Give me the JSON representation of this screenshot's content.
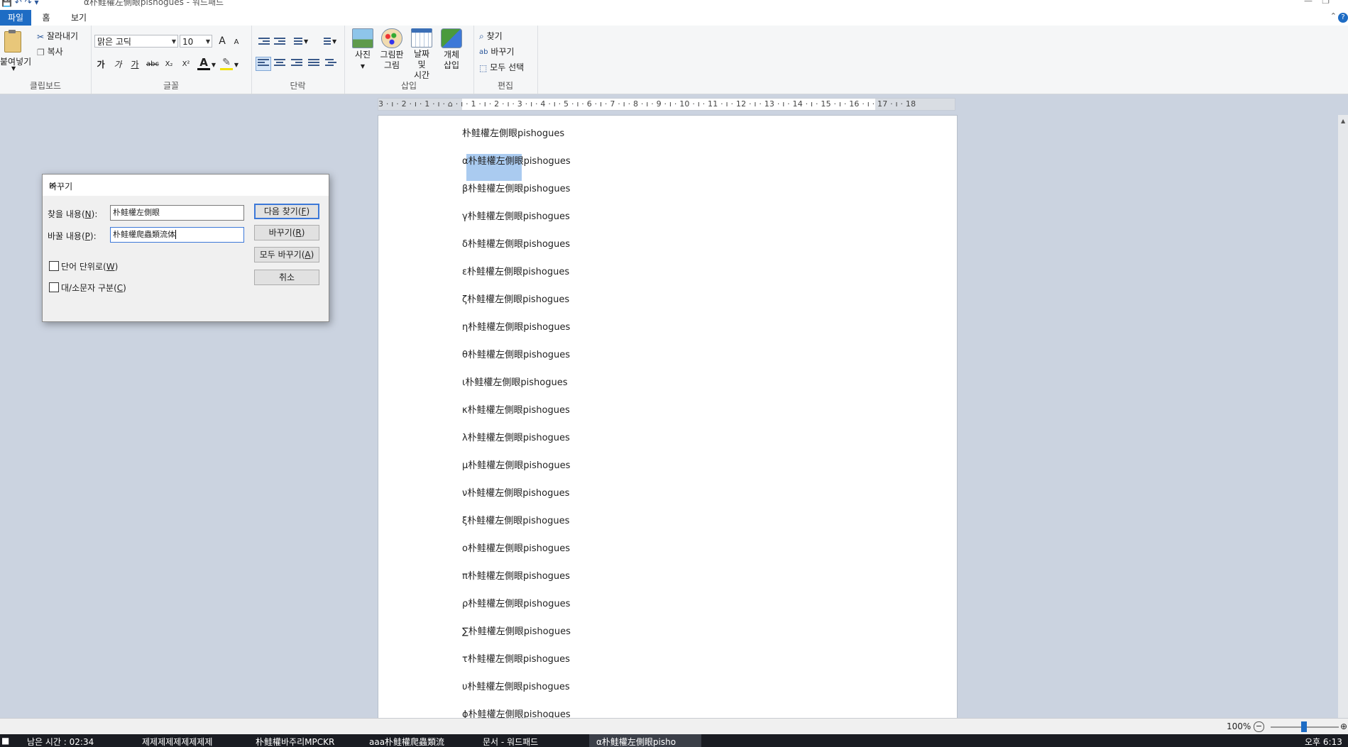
{
  "window": {
    "title": "α朴鲑權左側眼pishogues - 워드패드",
    "qat": "💾 ↶ ↷ ▾"
  },
  "menu": {
    "file": "파일",
    "home": "홈",
    "view": "보기"
  },
  "ribbon": {
    "clipboard": {
      "paste": "붙여넣기",
      "cut": "잘라내기",
      "copy": "복사",
      "label": "클립보드"
    },
    "font": {
      "family": "맑은 고딕",
      "size": "10",
      "grow": "A",
      "shrink": "A",
      "bold": "가",
      "italic": "가",
      "underline": "가",
      "strike": "abc",
      "subscript": "X₂",
      "superscript": "X²",
      "color": "A",
      "label": "글꼴"
    },
    "paragraph": {
      "label": "단락"
    },
    "insert": {
      "picture": "사진",
      "paint_line1": "그림판",
      "paint_line2": "그림",
      "datetime_line1": "날짜 및",
      "datetime_line2": "시간",
      "object_line1": "개체",
      "object_line2": "삽입",
      "label": "삽입"
    },
    "edit": {
      "find": "찾기",
      "replace": "바꾸기",
      "select_all": "모두 선택",
      "label": "편집"
    }
  },
  "ruler": {
    "numbers": "3 · ı · 2 · ı · 1 · ı · ⌂ · ı · 1 · ı · 2 · ı · 3 · ı · 4 · ı · 5 · ı · 6 · ı · 7 · ı · 8 · ı · 9 · ı · 10 · ı · 11 · ı · 12 · ı · 13 · ı · 14 · ı · 15 · ı · 16 · ı · 17 · ı · 18"
  },
  "document": {
    "lines": [
      "朴鲑權左側眼pishogues",
      "α朴鲑權左側眼pishogues",
      "β朴鲑權左側眼pishogues",
      "γ朴鲑權左側眼pishogues",
      "δ朴鲑權左側眼pishogues",
      "ε朴鲑權左側眼pishogues",
      "ζ朴鲑權左側眼pishogues",
      "η朴鲑權左側眼pishogues",
      "θ朴鲑權左側眼pishogues",
      "ι朴鲑權左側眼pishogues",
      "κ朴鲑權左側眼pishogues",
      "λ朴鲑權左側眼pishogues",
      "μ朴鲑權左側眼pishogues",
      "ν朴鲑權左側眼pishogues",
      "ξ朴鲑權左側眼pishogues",
      "ο朴鲑權左側眼pishogues",
      "π朴鲑權左側眼pishogues",
      "ρ朴鲑權左側眼pishogues",
      "∑朴鲑權左側眼pishogues",
      "τ朴鲑權左側眼pishogues",
      "υ朴鲑權左側眼pishogues",
      "ϕ朴鲑權左側眼pishogues"
    ]
  },
  "dialog": {
    "title": "바꾸기",
    "find_label": "찾을 내용(",
    "find_key": "N",
    "replace_label": "바꿀 내용(",
    "replace_key": "P",
    "find_value": "朴鲑權左側眼",
    "replace_value": "朴鲑權爬蟲類流体",
    "whole_word": "단어 단위로(",
    "whole_word_key": "W",
    "match_case": "대/소문자 구분(",
    "match_case_key": "C",
    "find_next": "다음 찾기(",
    "find_next_key": "F",
    "replace_btn": "바꾸기(",
    "replace_btn_key": "R",
    "replace_all": "모두 바꾸기(",
    "replace_all_key": "A",
    "cancel": "취소"
  },
  "status": {
    "zoom": "100%"
  },
  "taskbar": {
    "items": [
      "남은 시간 : 02:34",
      "제제제제제제제제제",
      "朴鲑權바주리MPCKR",
      "aaa朴鲑權爬蟲類流",
      "문서 - 워드패드",
      "α朴鲑權左側眼pisho"
    ],
    "clock": "오후 6:13"
  },
  "colors": {
    "accent": "#1e6cc4",
    "selection": "#aacbf0",
    "workspace": "#cbd3e0"
  }
}
